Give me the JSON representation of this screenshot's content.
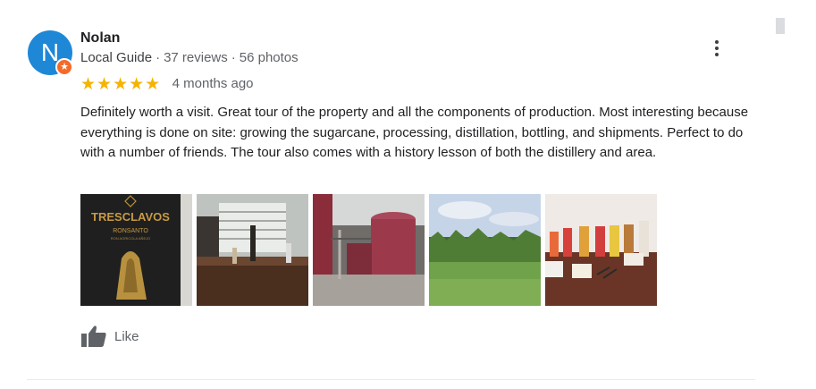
{
  "review": {
    "avatar_letter": "N",
    "author": "Nolan",
    "local_guide_label": "Local Guide",
    "reviews_count": "37 reviews",
    "photos_count": "56 photos",
    "stars": "★★★★★",
    "rating": 5,
    "time_ago": "4 months ago",
    "text": "Definitely worth a visit. Great tour of the property and all the components of production. Most interesting because everything is done on site: growing the sugarcane, processing, distillation, bottling, and shipments. Perfect to do with a number of friends. The tour also comes with a history lesson of both the distillery and area.",
    "photos": [
      {
        "brand": "TRESCLAVOS",
        "line1": "RONSANTO",
        "line2": "RON AGRICOLA AÑEJO"
      },
      {
        "label": ""
      },
      {
        "label": ""
      },
      {
        "label": ""
      },
      {
        "label": ""
      }
    ],
    "like_label": "Like"
  },
  "colors": {
    "avatar": "#1e88d7",
    "badge": "#f56a2a",
    "stars": "#f5b400",
    "text": "#202124",
    "muted": "#5f6368"
  },
  "icons": {
    "more": "more-vert-icon",
    "like": "thumb-up-icon",
    "badge": "local-guide-star-icon"
  }
}
